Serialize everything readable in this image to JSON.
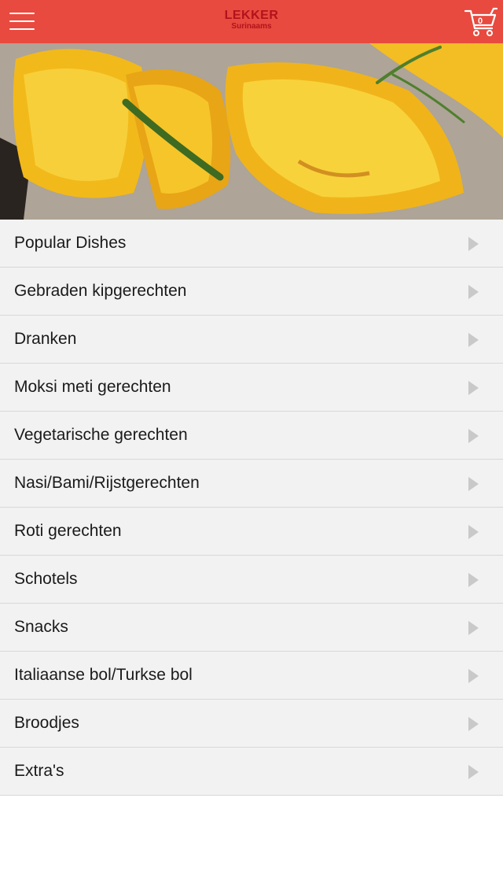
{
  "header": {
    "logo_main": "LEKKER",
    "logo_sub": "Surinaams",
    "cart_count": "0",
    "menu_icon": "hamburger-icon",
    "cart_icon": "shopping-cart-icon",
    "bar_color": "#e84a3f",
    "logo_color": "#b3121b"
  },
  "hero": {
    "image": "roasted pumpkin slices with rosemary"
  },
  "menu": {
    "arrow_icon": "chevron-right-icon",
    "items": [
      {
        "label": "Popular Dishes"
      },
      {
        "label": "Gebraden kipgerechten"
      },
      {
        "label": "Dranken"
      },
      {
        "label": "Moksi meti gerechten"
      },
      {
        "label": "Vegetarische gerechten"
      },
      {
        "label": "Nasi/Bami/Rijstgerechten"
      },
      {
        "label": "Roti gerechten"
      },
      {
        "label": "Schotels"
      },
      {
        "label": "Snacks"
      },
      {
        "label": "Italiaanse bol/Turkse bol"
      },
      {
        "label": "Broodjes"
      },
      {
        "label": "Extra's"
      }
    ]
  }
}
